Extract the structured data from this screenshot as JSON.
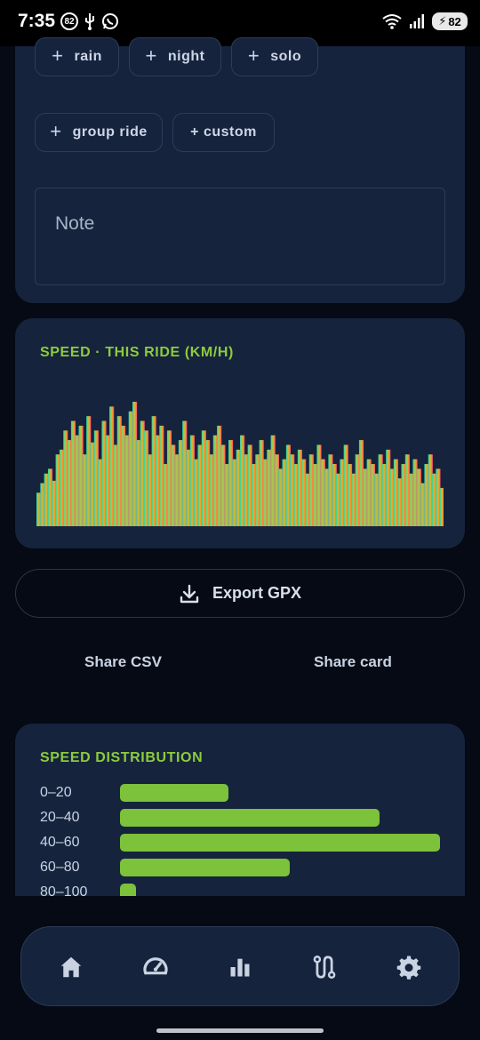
{
  "status": {
    "time": "7:35",
    "badge": "82",
    "battery": "82"
  },
  "tags": {
    "rain": "rain",
    "night": "night",
    "solo": "solo",
    "group_ride": "group ride",
    "custom": "+ custom"
  },
  "note": {
    "placeholder": "Note"
  },
  "speed_card": {
    "title": "SPEED · THIS RIDE (KM/H)"
  },
  "actions": {
    "export_gpx": "Export GPX",
    "share_csv": "Share CSV",
    "share_card": "Share card"
  },
  "distribution": {
    "title": "SPEED DISTRIBUTION",
    "rows": [
      {
        "label": "0–20",
        "fraction": 0.34
      },
      {
        "label": "20–40",
        "fraction": 0.81
      },
      {
        "label": "40–60",
        "fraction": 1.0
      },
      {
        "label": "60–80",
        "fraction": 0.53
      },
      {
        "label": "80–100",
        "fraction": 0.05
      }
    ]
  },
  "chart_data": {
    "type": "bar",
    "title": "SPEED · THIS RIDE (KM/H)",
    "gradient": [
      "#22d6b0",
      "#8fcf5a",
      "#f5a623",
      "#ff4d7d"
    ],
    "series": [
      {
        "values": [
          14,
          18,
          22,
          24,
          19,
          30,
          32,
          40,
          36,
          44,
          38,
          42,
          30,
          46,
          35,
          40,
          28,
          44,
          38,
          50,
          34,
          46,
          42,
          38,
          48,
          52,
          36,
          44,
          40,
          30,
          46,
          38,
          42,
          26,
          40,
          34,
          30,
          36,
          44,
          32,
          38,
          28,
          34,
          40,
          36,
          30,
          38,
          42,
          34,
          26,
          36,
          28,
          32,
          38,
          30,
          34,
          26,
          30,
          36,
          28,
          32,
          38,
          30,
          24,
          28,
          34,
          30,
          26,
          32,
          28,
          22,
          30,
          26,
          34,
          28,
          24,
          30,
          26,
          22,
          28,
          34,
          26,
          22,
          30,
          36,
          24,
          28,
          26,
          22,
          30,
          26,
          32,
          24,
          28,
          20,
          26,
          30,
          22,
          28,
          24,
          18,
          26,
          30,
          22,
          24,
          16
        ]
      }
    ]
  },
  "nav": {
    "items": [
      "home-icon",
      "speedometer-icon",
      "bar-chart-icon",
      "route-icon",
      "gear-icon"
    ]
  },
  "colors": {
    "accent": "#8ccc3a",
    "card": "#16233d",
    "background": "#050a14"
  }
}
